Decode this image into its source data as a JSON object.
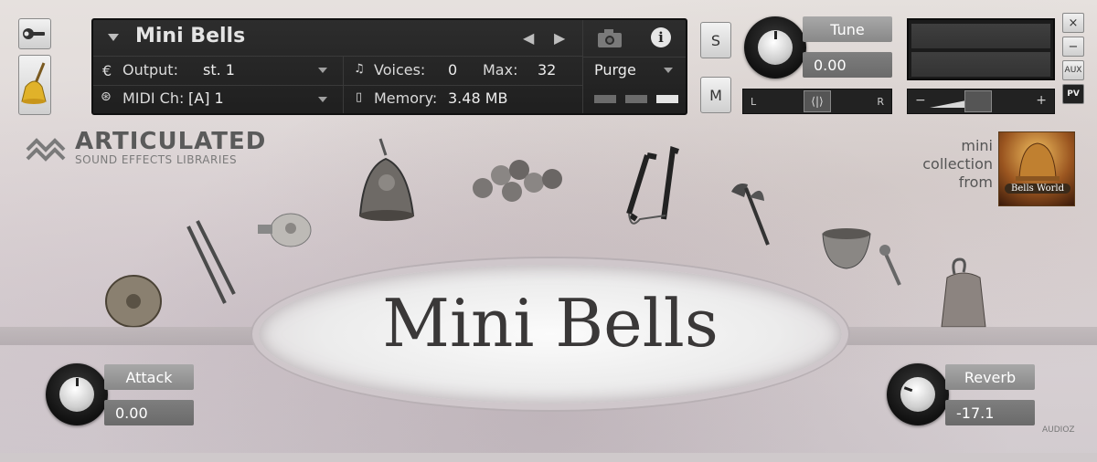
{
  "header": {
    "instrument_name": "Mini Bells",
    "output_label": "Output:",
    "output_value": "st. 1",
    "midi_label": "MIDI Ch:",
    "midi_value": "[A]  1",
    "voices_label": "Voices:",
    "voices_value": "0",
    "max_label": "Max:",
    "max_value": "32",
    "memory_label": "Memory:",
    "memory_value": "3.48 MB",
    "purge_label": "Purge",
    "solo_label": "S",
    "mute_label": "M",
    "tune_label": "Tune",
    "tune_value": "0.00",
    "pan_left": "L",
    "pan_right": "R",
    "vol_minus": "−",
    "vol_plus": "+",
    "side_buttons": [
      "×",
      "−",
      "AUX",
      "PV"
    ]
  },
  "brand": {
    "title": "ARTICULATED",
    "subtitle": "SOUND EFFECTS LIBRARIES"
  },
  "collection": {
    "line1": "mini",
    "line2": "collection",
    "line3": "from",
    "badge": "Bells World"
  },
  "main": {
    "title": "Mini Bells"
  },
  "controls": {
    "attack_label": "Attack",
    "attack_value": "0.00",
    "reverb_label": "Reverb",
    "reverb_value": "-17.1"
  },
  "watermark": "AUDIOZ",
  "colors": {
    "rack_bg": "#262626",
    "panel_bg": "#ddd5d6",
    "label_box": "#999999"
  }
}
